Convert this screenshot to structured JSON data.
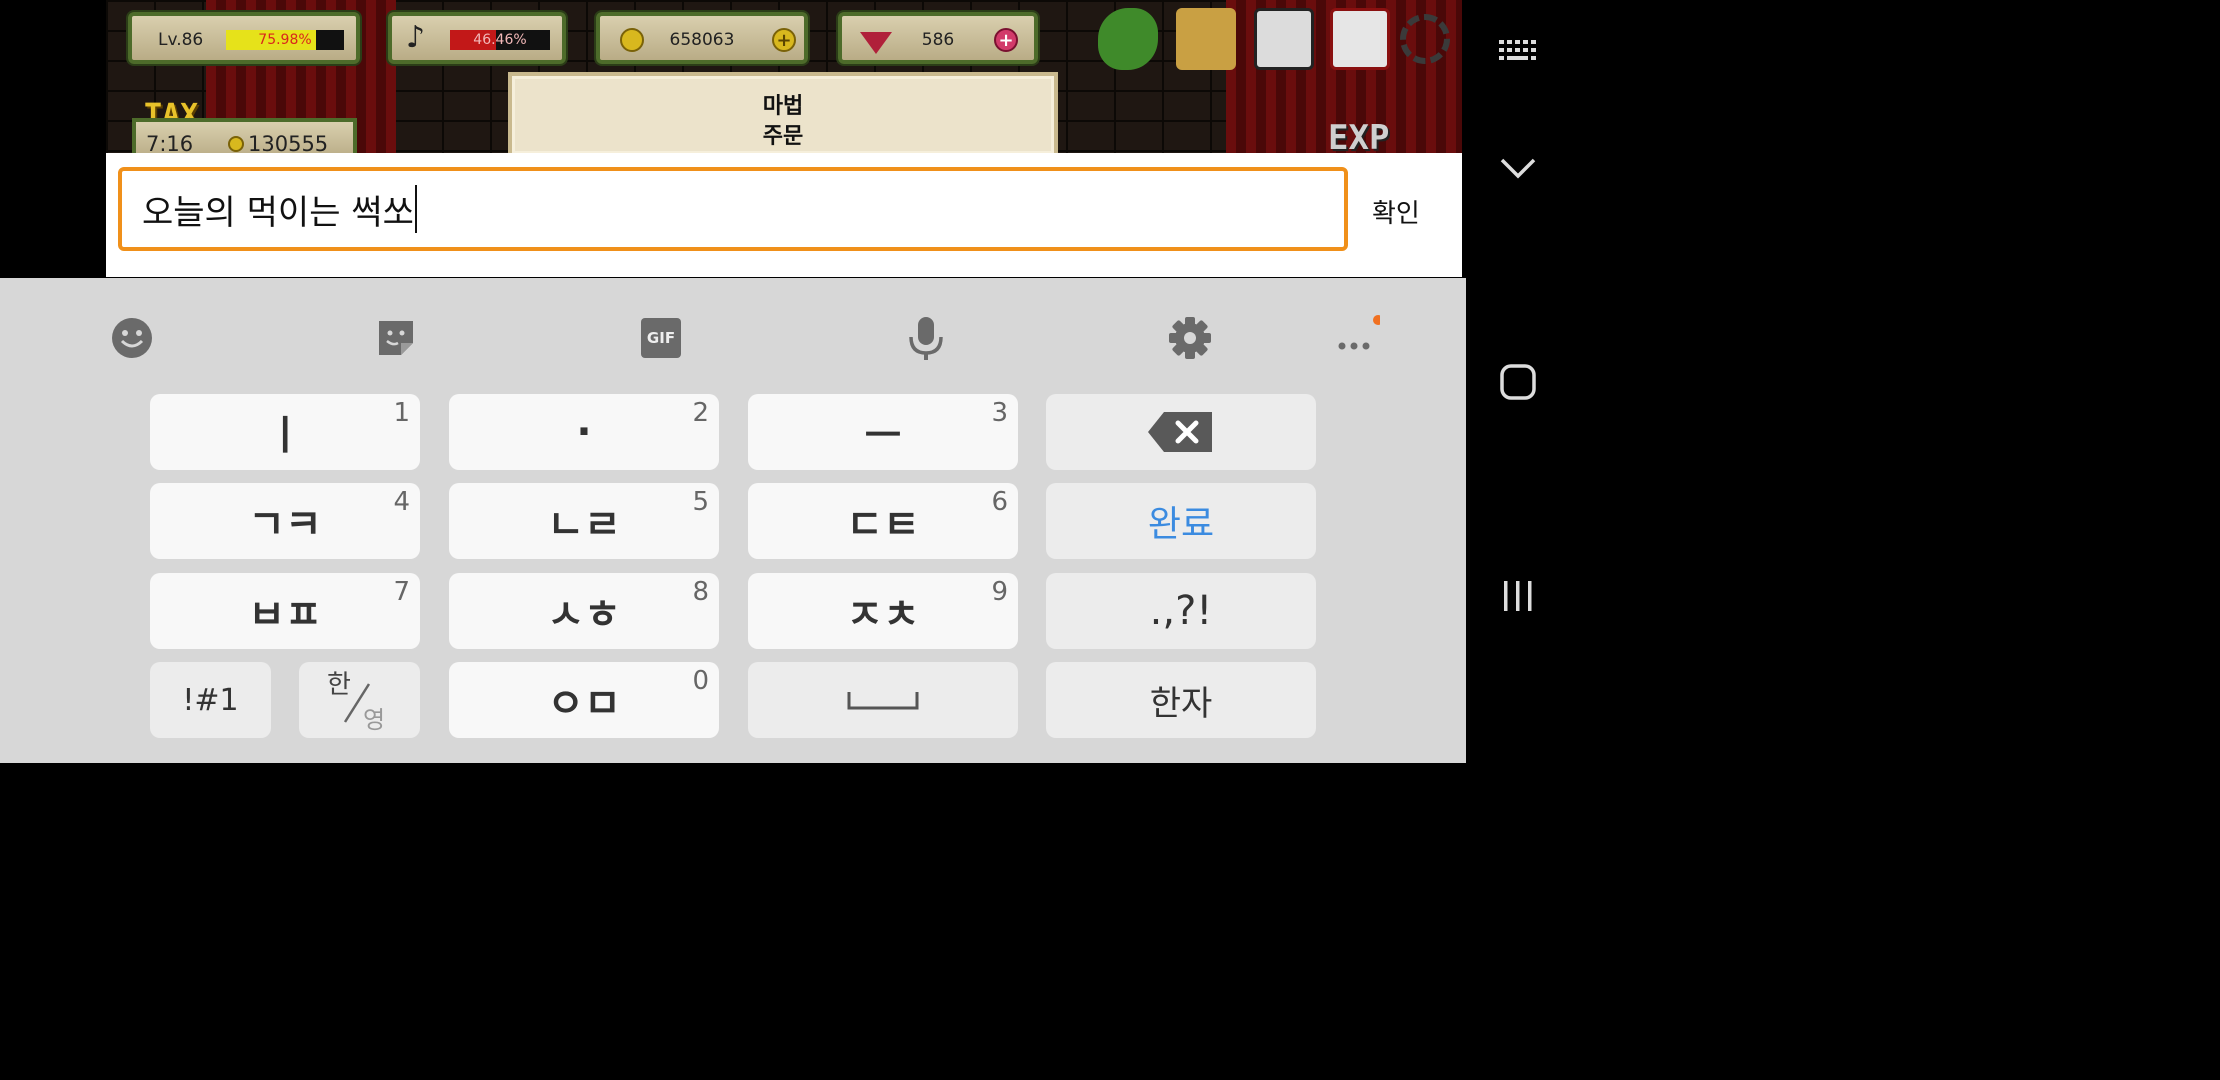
{
  "game": {
    "level": "Lv.86",
    "level_percent": "75.98%",
    "level_fraction": 0.7598,
    "music_percent": "46.46%",
    "music_fraction": 0.4646,
    "gold": "658063",
    "gems": "586",
    "tax_label": "TAX",
    "tax_time": "7:16",
    "tax_amount": "130555",
    "exp_label": "EXP",
    "panel_title_line1": "마법",
    "panel_title_line2": "주문"
  },
  "input": {
    "value": "오늘의 먹이는 썩쏘",
    "confirm_label": "확인",
    "border_color": "#f0901a"
  },
  "keyboard": {
    "toolbar": [
      "emoji-icon",
      "sticker-icon",
      "gif-icon",
      "microphone-icon",
      "settings-icon",
      "more-icon"
    ],
    "gif_label": "GIF",
    "rows": [
      [
        {
          "label": "ㅣ",
          "num": "1"
        },
        {
          "label": "·",
          "num": "2"
        },
        {
          "label": "ㅡ",
          "num": "3"
        },
        {
          "label": "backspace",
          "num": ""
        }
      ],
      [
        {
          "label": "ㄱㅋ",
          "num": "4"
        },
        {
          "label": "ㄴㄹ",
          "num": "5"
        },
        {
          "label": "ㄷㅌ",
          "num": "6"
        },
        {
          "label": "완료",
          "num": ""
        }
      ],
      [
        {
          "label": "ㅂㅍ",
          "num": "7"
        },
        {
          "label": "ㅅㅎ",
          "num": "8"
        },
        {
          "label": "ㅈㅊ",
          "num": "9"
        },
        {
          "label": ".,?!",
          "num": ""
        }
      ],
      [
        {
          "label": "!#1",
          "num": ""
        },
        {
          "label": "한/영",
          "num": ""
        },
        {
          "label": "ㅇㅁ",
          "num": "0"
        },
        {
          "label": "space",
          "num": ""
        },
        {
          "label": "한자",
          "num": ""
        }
      ]
    ],
    "k1": "ㅣ",
    "k2": "·",
    "k3": "ㅡ",
    "k4": "ㄱㅋ",
    "k5": "ㄴㄹ",
    "k6": "ㄷㅌ",
    "k7": "ㅂㅍ",
    "k8": "ㅅㅎ",
    "k9": "ㅈㅊ",
    "k0": "ㅇㅁ",
    "n1": "1",
    "n2": "2",
    "n3": "3",
    "n4": "4",
    "n5": "5",
    "n6": "6",
    "n7": "7",
    "n8": "8",
    "n9": "9",
    "n0": "0",
    "done_label": "완료",
    "punct_label": ".,?!",
    "symbols_label": "!#1",
    "lang_top": "한",
    "lang_bottom": "영",
    "hanja_label": "한자",
    "accent_color": "#3b8be0",
    "notification_dot_color": "#f07020"
  },
  "navbar": {
    "icons": [
      "keyboard-hide-icon",
      "chevron-down-icon",
      "home-icon",
      "recents-icon"
    ]
  }
}
